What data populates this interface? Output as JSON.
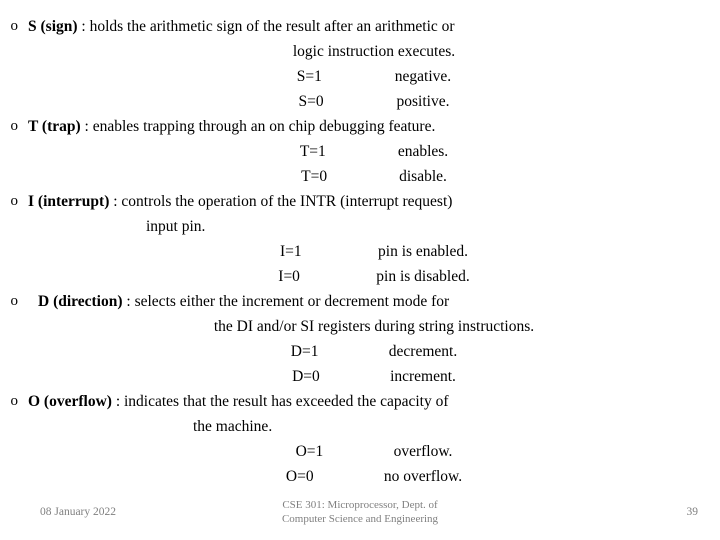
{
  "slide": {
    "bullets": [
      {
        "marker": "o",
        "lead_term": "S (sign)",
        "lead_rest": " : holds the arithmetic sign of the result after an arithmetic or",
        "cont_lines": [
          "logic instruction executes."
        ],
        "pairs": [
          {
            "key": "S=1",
            "value": "negative."
          },
          {
            "key": "S=0",
            "value": "positive."
          }
        ]
      },
      {
        "marker": "o",
        "lead_term": "T (trap)",
        "lead_rest": " : enables trapping through an on chip debugging feature.",
        "cont_lines": [],
        "pairs": [
          {
            "key": "T=1",
            "value": "enables."
          },
          {
            "key": "T=0",
            "value": "disable."
          }
        ]
      },
      {
        "marker": "o",
        "lead_term": "I (interrupt)",
        "lead_rest": " : controls the operation of the INTR (interrupt request)",
        "cont_lines": [
          "input pin."
        ],
        "pairs": [
          {
            "key": "I=1",
            "value": "pin is enabled."
          },
          {
            "key": "I=0",
            "value": "pin is disabled."
          }
        ]
      },
      {
        "marker": "o",
        "lead_term": "D (direction)",
        "lead_rest": " : selects either the increment or decrement mode for",
        "cont_lines": [
          "the DI and/or SI registers during string instructions."
        ],
        "pairs": [
          {
            "key": "D=1",
            "value": "decrement."
          },
          {
            "key": "D=0",
            "value": "increment."
          }
        ]
      },
      {
        "marker": "o",
        "lead_term": "O (overflow)",
        "lead_rest": " : indicates that the result has exceeded the capacity of",
        "cont_lines": [
          "the machine."
        ],
        "pairs": [
          {
            "key": "O=1",
            "value": "overflow."
          },
          {
            "key": "O=0",
            "value": "no overflow."
          }
        ]
      }
    ],
    "footer": {
      "date": "08 January 2022",
      "center_line1": "CSE 301: Microprocessor, Dept. of",
      "center_line2": "Computer Science and Engineering",
      "page_number": "39"
    }
  }
}
